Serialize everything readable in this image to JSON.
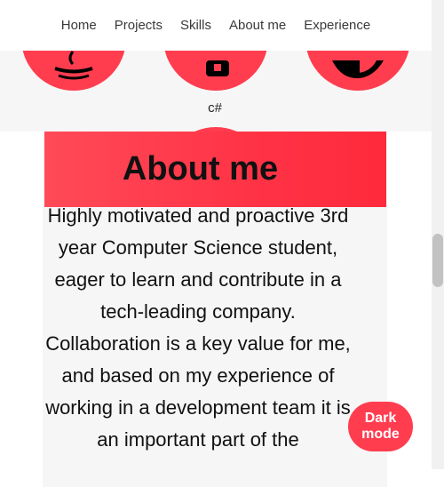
{
  "nav": {
    "items": [
      "Home",
      "Projects",
      "Skills",
      "About me",
      "Experience"
    ]
  },
  "skills": {
    "icons": [
      "java-icon",
      "csharp-icon",
      "globe-icon"
    ],
    "visible_label": "c#"
  },
  "about": {
    "title": "About me",
    "text": "Highly motivated and proactive 3rd year Computer Science student, eager to learn and contribute in a tech-leading company. Collaboration is a key value for me, and based on my experience of working in a development team it is an important part of the"
  },
  "dark_mode": {
    "label": "Dark mode"
  },
  "colors": {
    "accent": "#ff3d4f",
    "card_bg": "#f6f6f6"
  }
}
